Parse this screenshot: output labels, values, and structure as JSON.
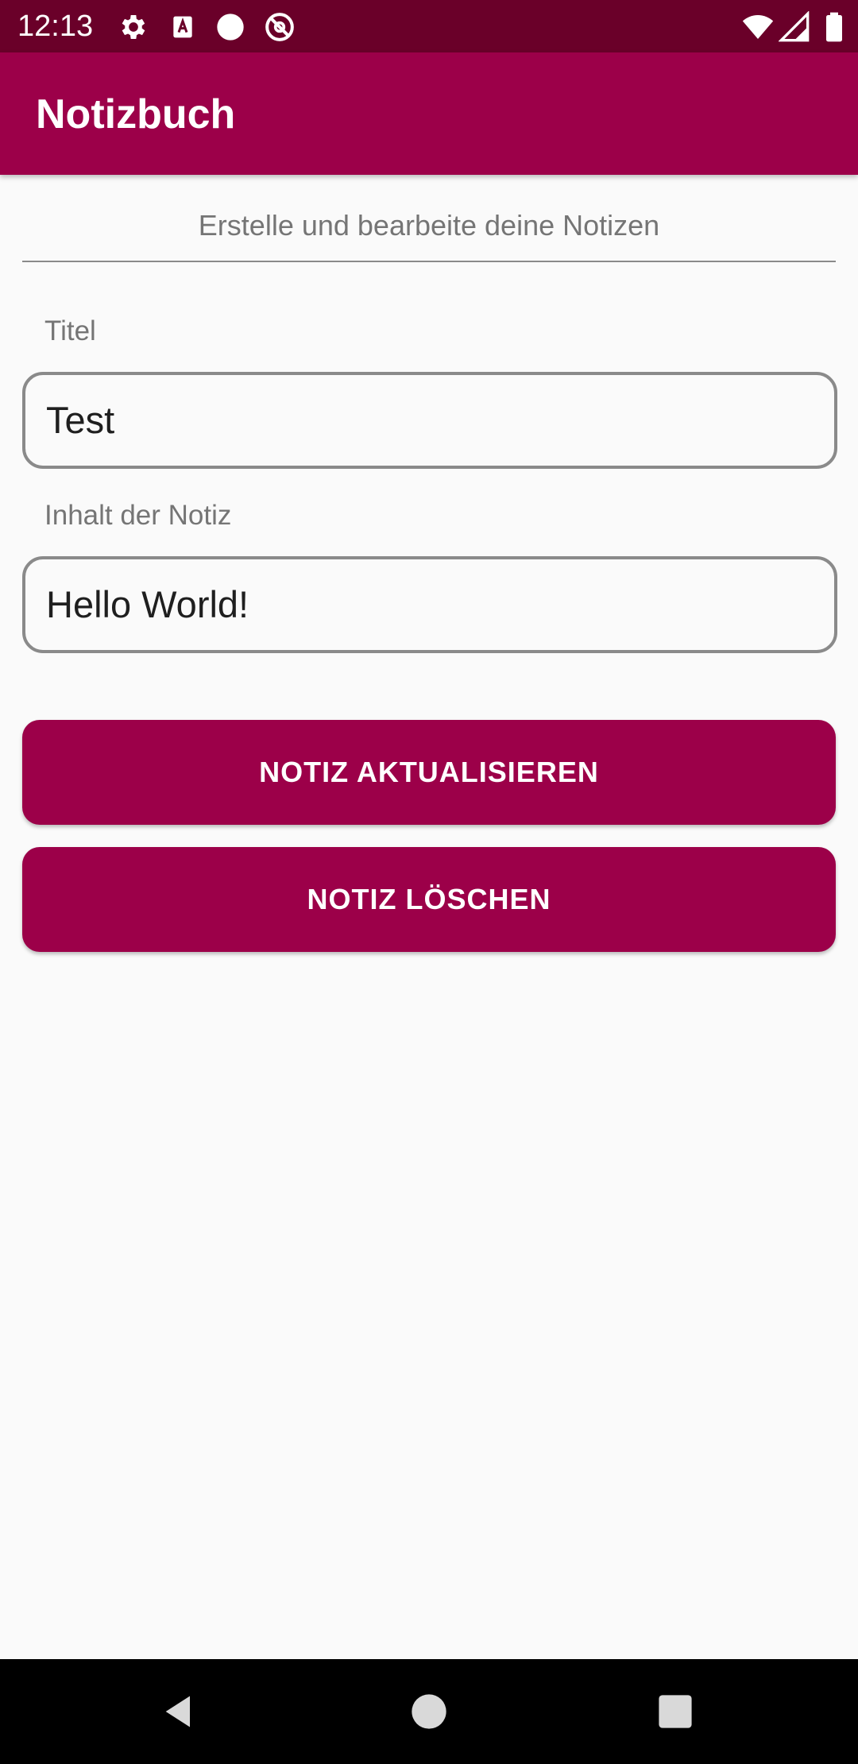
{
  "status_bar": {
    "time": "12:13",
    "left_icons": [
      "settings-icon",
      "keyboard-a-icon",
      "circle-dot-icon",
      "blocked-at-icon"
    ],
    "right_icons": [
      "wifi-icon",
      "cell-signal-icon",
      "battery-icon"
    ],
    "background": "#6a0029"
  },
  "app_bar": {
    "title": "Notizbuch",
    "background": "#9c0049"
  },
  "main": {
    "subtitle": "Erstelle und bearbeite deine Notizen",
    "title_field": {
      "label": "Titel",
      "value": "Test"
    },
    "content_field": {
      "label": "Inhalt der Notiz",
      "value": "Hello World!"
    },
    "buttons": {
      "update_label": "NOTIZ AKTUALISIEREN",
      "delete_label": "NOTIZ LÖSCHEN"
    },
    "accent_color": "#9c0049"
  },
  "nav_bar": {
    "icons": [
      "back-triangle-icon",
      "home-circle-icon",
      "recents-square-icon"
    ]
  }
}
